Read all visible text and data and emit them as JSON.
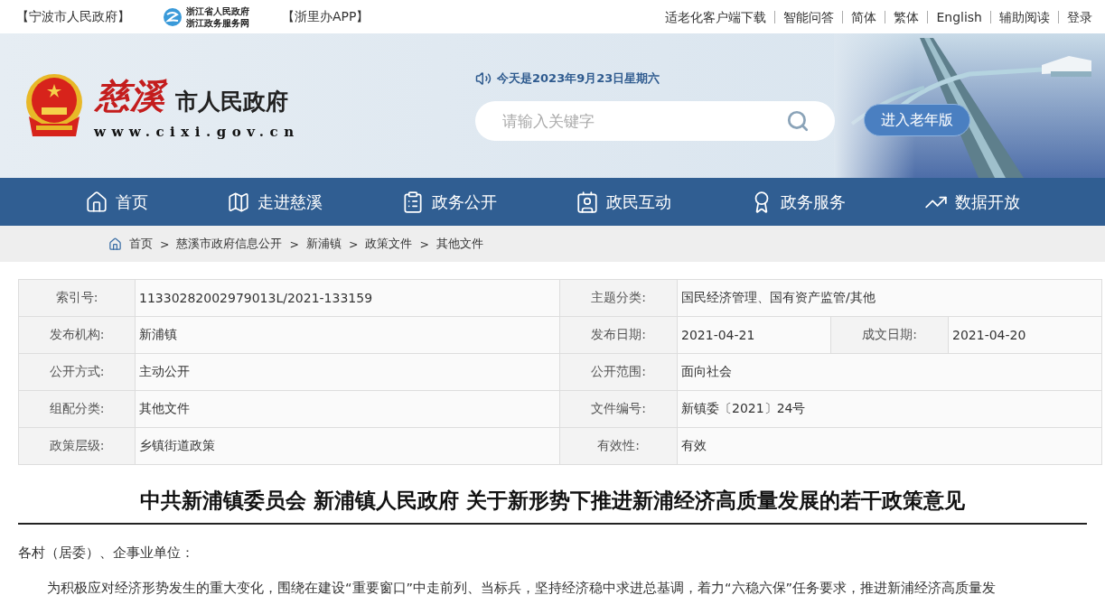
{
  "top_bar": {
    "left_links": [
      "【宁波市人民政府】",
      "【浙里办APP】"
    ],
    "zj_logo": {
      "line_1": "浙江省人民政府",
      "line_2": "浙江政务服务网"
    },
    "right_links": [
      "适老化客户端下载",
      "智能问答",
      "简体",
      "繁体",
      "English",
      "辅助阅读",
      "登录"
    ]
  },
  "header": {
    "logo_script": "慈溪",
    "logo_title": "市人民政府",
    "logo_url": "www.cixi.gov.cn",
    "date": "今天是2023年9月23日星期六",
    "search": {
      "placeholder": "请输入关键字"
    },
    "elder_button": "进入老年版"
  },
  "nav": [
    "首页",
    "走进慈溪",
    "政务公开",
    "政民互动",
    "政务服务",
    "数据开放"
  ],
  "breadcrumb": {
    "items": [
      "首页",
      "慈溪市政府信息公开",
      "新浦镇",
      "政策文件",
      "其他文件"
    ],
    "separator": ">"
  },
  "info_table": [
    {
      "pairs": [
        {
          "label": "索引号:",
          "value": "11330282002979013L/2021-133159"
        },
        {
          "label": "主题分类:",
          "value": "国民经济管理、国有资产监管/其他"
        }
      ]
    },
    {
      "pairs": [
        {
          "label": "发布机构:",
          "value": "新浦镇"
        },
        {
          "label": "发布日期:",
          "value": "2021-04-21"
        },
        {
          "label": "成文日期:",
          "value": "2021-04-20"
        }
      ]
    },
    {
      "pairs": [
        {
          "label": "公开方式:",
          "value": "主动公开"
        },
        {
          "label": "公开范围:",
          "value": "面向社会"
        }
      ]
    },
    {
      "pairs": [
        {
          "label": "组配分类:",
          "value": "其他文件"
        },
        {
          "label": "文件编号:",
          "value": "新镇委〔2021〕24号"
        }
      ]
    },
    {
      "pairs": [
        {
          "label": "政策层级:",
          "value": "乡镇街道政策"
        },
        {
          "label": "有效性:",
          "value": "有效"
        }
      ]
    }
  ],
  "article": {
    "title": "中共新浦镇委员会 新浦镇人民政府 关于新形势下推进新浦经济高质量发展的若干政策意见",
    "salutation": "各村（居委）、企事业单位：",
    "paragraphs": [
      "为积极应对经济形势发生的重大变化，围绕在建设“重要窗口”中走前列、当标兵，坚持经济稳中求进总基调，着力“六稳六保”任务要求，推进新浦经济高质量发"
    ]
  }
}
